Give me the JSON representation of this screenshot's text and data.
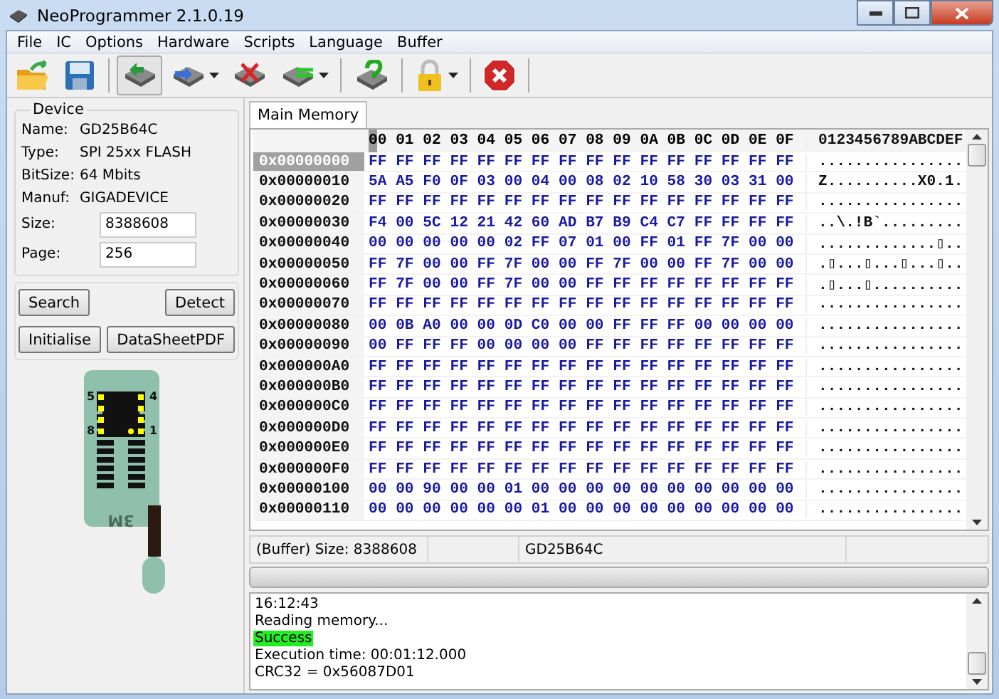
{
  "window": {
    "title": "NeoProgrammer 2.1.0.19"
  },
  "menu": [
    "File",
    "IC",
    "Options",
    "Hardware",
    "Scripts",
    "Language",
    "Buffer"
  ],
  "device": {
    "legend": "Device",
    "info": [
      {
        "label": "Name:",
        "value": "GD25B64C"
      },
      {
        "label": "Type:",
        "value": "SPI 25xx FLASH"
      },
      {
        "label": "BitSize:",
        "value": "64 Mbits"
      },
      {
        "label": "Manuf:",
        "value": "GIGADEVICE"
      }
    ],
    "fields": [
      {
        "label": "Size:",
        "value": "8388608"
      },
      {
        "label": "Page:",
        "value": "256"
      }
    ]
  },
  "buttons": [
    [
      "Search",
      "Detect"
    ],
    [
      "Initialise",
      "DataSheetPDF"
    ]
  ],
  "socket": {
    "pin_labels": [
      "5",
      "4",
      "8",
      "1"
    ],
    "brand": "3M"
  },
  "tabs": [
    {
      "label": "Main Memory",
      "selected": true
    }
  ],
  "hex": {
    "header": "00 01 02 03 04 05 06 07 08 09 0A 0B 0C 0D 0E 0F",
    "ascii_header": "0123456789ABCDEF",
    "rows": [
      {
        "address": "0x00000000",
        "bytes": "FF FF FF FF FF FF FF FF FF FF FF FF FF FF FF FF",
        "ascii": "................",
        "selected": true
      },
      {
        "address": "0x00000010",
        "bytes": "5A A5 F0 0F 03 00 04 00 08 02 10 58 30 03 31 00",
        "ascii": "Z..........X0.1.",
        "selected": false
      },
      {
        "address": "0x00000020",
        "bytes": "FF FF FF FF FF FF FF FF FF FF FF FF FF FF FF FF",
        "ascii": "................",
        "selected": false
      },
      {
        "address": "0x00000030",
        "bytes": "F4 00 5C 12 21 42 60 AD B7 B9 C4 C7 FF FF FF FF",
        "ascii": "..\\.!B`.........",
        "selected": false
      },
      {
        "address": "0x00000040",
        "bytes": "00 00 00 00 00 02 FF 07 01 00 FF 01 FF 7F 00 00",
        "ascii": ".............▯..",
        "selected": false
      },
      {
        "address": "0x00000050",
        "bytes": "FF 7F 00 00 FF 7F 00 00 FF 7F 00 00 FF 7F 00 00",
        "ascii": ".▯...▯...▯...▯..",
        "selected": false
      },
      {
        "address": "0x00000060",
        "bytes": "FF 7F 00 00 FF 7F 00 00 FF FF FF FF FF FF FF FF",
        "ascii": ".▯...▯..........",
        "selected": false
      },
      {
        "address": "0x00000070",
        "bytes": "FF FF FF FF FF FF FF FF FF FF FF FF FF FF FF FF",
        "ascii": "................",
        "selected": false
      },
      {
        "address": "0x00000080",
        "bytes": "00 0B A0 00 00 0D C0 00 00 FF FF FF 00 00 00 00",
        "ascii": "................",
        "selected": false
      },
      {
        "address": "0x00000090",
        "bytes": "00 FF FF FF 00 00 00 00 FF FF FF FF FF FF FF FF",
        "ascii": "................",
        "selected": false
      },
      {
        "address": "0x000000A0",
        "bytes": "FF FF FF FF FF FF FF FF FF FF FF FF FF FF FF FF",
        "ascii": "................",
        "selected": false
      },
      {
        "address": "0x000000B0",
        "bytes": "FF FF FF FF FF FF FF FF FF FF FF FF FF FF FF FF",
        "ascii": "................",
        "selected": false
      },
      {
        "address": "0x000000C0",
        "bytes": "FF FF FF FF FF FF FF FF FF FF FF FF FF FF FF FF",
        "ascii": "................",
        "selected": false
      },
      {
        "address": "0x000000D0",
        "bytes": "FF FF FF FF FF FF FF FF FF FF FF FF FF FF FF FF",
        "ascii": "................",
        "selected": false
      },
      {
        "address": "0x000000E0",
        "bytes": "FF FF FF FF FF FF FF FF FF FF FF FF FF FF FF FF",
        "ascii": "................",
        "selected": false
      },
      {
        "address": "0x000000F0",
        "bytes": "FF FF FF FF FF FF FF FF FF FF FF FF FF FF FF FF",
        "ascii": "................",
        "selected": false
      },
      {
        "address": "0x00000100",
        "bytes": "00 00 90 00 00 01 00 00 00 00 00 00 00 00 00 00",
        "ascii": "................",
        "selected": false
      },
      {
        "address": "0x00000110",
        "bytes": "00 00 00 00 00 00 01 00 00 00 00 00 00 00 00 00",
        "ascii": "................",
        "selected": false
      }
    ]
  },
  "status_bar": {
    "buffer": "(Buffer) Size: 8388608",
    "chip": "GD25B64C"
  },
  "progress": {
    "level": 0
  },
  "log": [
    {
      "text": "16:12:43",
      "highlight": false
    },
    {
      "text": "Reading memory...",
      "highlight": false
    },
    {
      "text": "Success",
      "highlight": true
    },
    {
      "text": "Execution time: 00:01:12.000",
      "highlight": false
    },
    {
      "text": "CRC32 = 0x56087D01",
      "highlight": false
    }
  ]
}
